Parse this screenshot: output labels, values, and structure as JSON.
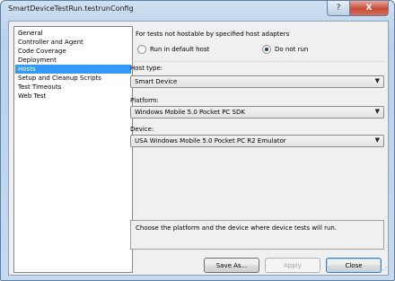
{
  "window": {
    "title": "SmartDeviceTestRun.testrunConfig",
    "help_label": "?",
    "close_label": "X"
  },
  "nav": {
    "items": [
      "General",
      "Controller and Agent",
      "Code Coverage",
      "Deployment",
      "Hosts",
      "Setup and Cleanup Scripts",
      "Test Timeouts",
      "Web Test"
    ],
    "selected": "Hosts"
  },
  "hosts": {
    "group_title": "For tests not hostable by specified host adapters",
    "radio_default": "Run in default host",
    "radio_donotrun": "Do not run",
    "selected_radio": "Do not run",
    "host_type_label": "Host type:",
    "host_type_value": "Smart Device",
    "platform_label": "Platform:",
    "platform_value": "Windows Mobile 5.0 Pocket PC SDK",
    "device_label": "Device:",
    "device_value": "USA Windows Mobile 5.0 Pocket PC R2 Emulator",
    "description": "Choose the platform and the device where device tests will run."
  },
  "buttons": {
    "save_as": "Save As...",
    "apply": "Apply",
    "close": "Close"
  },
  "colors": {
    "selection": "#3399ff",
    "titlebar": "#c6d9ee"
  }
}
